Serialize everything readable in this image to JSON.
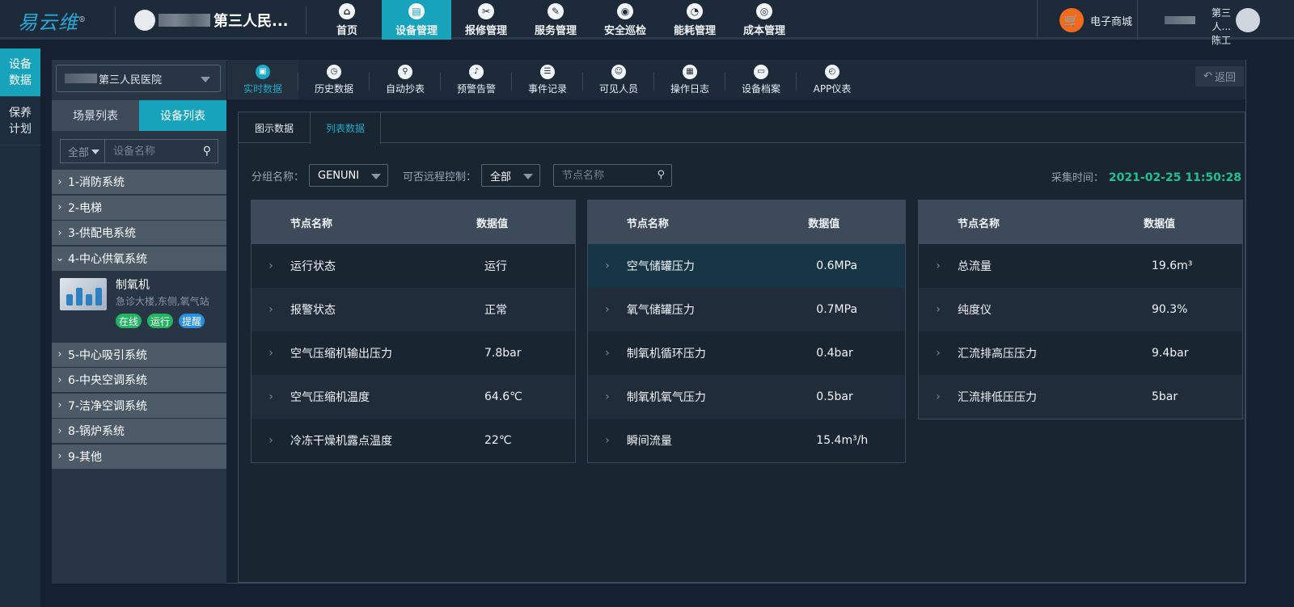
{
  "header": {
    "logo": "易云维",
    "logo_mark": "®",
    "hospital_name": "第三人民...",
    "nav": [
      {
        "label": "首页",
        "icon": "home-icon",
        "glyph": "⌂"
      },
      {
        "label": "设备管理",
        "icon": "device-icon",
        "glyph": "▤"
      },
      {
        "label": "报修管理",
        "icon": "repair-icon",
        "glyph": "✂"
      },
      {
        "label": "服务管理",
        "icon": "service-icon",
        "glyph": "✎"
      },
      {
        "label": "安全巡检",
        "icon": "patrol-icon",
        "glyph": "◉"
      },
      {
        "label": "能耗管理",
        "icon": "energy-icon",
        "glyph": "◔"
      },
      {
        "label": "成本管理",
        "icon": "cost-icon",
        "glyph": "◎"
      }
    ],
    "active_nav": 1,
    "shop_label": "电子商城",
    "user_org": "第三人...",
    "user_name": "陈工"
  },
  "leftbar": {
    "items": [
      {
        "label": "设备数据",
        "line1": "设备",
        "line2": "数据"
      },
      {
        "label": "保养计划",
        "line1": "保养",
        "line2": "计划"
      }
    ]
  },
  "sidebar": {
    "hospital_select": "第三人民医院",
    "tabs": [
      "场景列表",
      "设备列表"
    ],
    "active_tab": 1,
    "filter_all": "全部",
    "search_placeholder": "设备名称",
    "tree": [
      {
        "label": "1-消防系统",
        "expanded": false
      },
      {
        "label": "2-电梯",
        "expanded": false
      },
      {
        "label": "3-供配电系统",
        "expanded": false
      },
      {
        "label": "4-中心供氧系统",
        "expanded": true
      },
      {
        "label": "5-中心吸引系统",
        "expanded": false
      },
      {
        "label": "6-中央空调系统",
        "expanded": false
      },
      {
        "label": "7-洁净空调系统",
        "expanded": false
      },
      {
        "label": "8-锅炉系统",
        "expanded": false
      },
      {
        "label": "9-其他",
        "expanded": false
      }
    ],
    "device": {
      "name": "制氧机",
      "location": "急诊大楼,东侧,氧气站",
      "badges": [
        "在线",
        "运行",
        "提醒"
      ]
    }
  },
  "subnav": {
    "items": [
      {
        "label": "实时数据",
        "icon": "realtime-icon",
        "glyph": "▣"
      },
      {
        "label": "历史数据",
        "icon": "history-icon",
        "glyph": "◷"
      },
      {
        "label": "自动抄表",
        "icon": "meter-icon",
        "glyph": "⚲"
      },
      {
        "label": "预警告警",
        "icon": "alarm-bell-icon",
        "glyph": "♪"
      },
      {
        "label": "事件记录",
        "icon": "event-log-icon",
        "glyph": "☰"
      },
      {
        "label": "可见人员",
        "icon": "people-icon",
        "glyph": "☺"
      },
      {
        "label": "操作日志",
        "icon": "operation-log-icon",
        "glyph": "▦"
      },
      {
        "label": "设备档案",
        "icon": "archive-icon",
        "glyph": "▭"
      },
      {
        "label": "APP仪表",
        "icon": "gauge-icon",
        "glyph": "◴"
      }
    ],
    "active": 0,
    "back_label": "返回"
  },
  "main": {
    "tabs": [
      "图示数据",
      "列表数据"
    ],
    "active_tab": 1,
    "group_label": "分组名称：",
    "group_value": "GENUNI",
    "remote_label": "可否远程控制：",
    "remote_value": "全部",
    "node_placeholder": "节点名称",
    "collect_label": "采集时间：",
    "collect_time": "2021-02-25 11:50:28",
    "col_name": "节点名称",
    "col_value": "数据值",
    "tables": [
      {
        "rows": [
          {
            "name": "运行状态",
            "value": "运行"
          },
          {
            "name": "报警状态",
            "value": "正常"
          },
          {
            "name": "空气压缩机输出压力",
            "value": "7.8bar"
          },
          {
            "name": "空气压缩机温度",
            "value": "64.6℃"
          },
          {
            "name": "冷冻干燥机露点温度",
            "value": "22℃"
          }
        ]
      },
      {
        "rows": [
          {
            "name": "空气储罐压力",
            "value": "0.6MPa"
          },
          {
            "name": "氧气储罐压力",
            "value": "0.7MPa"
          },
          {
            "name": "制氧机循环压力",
            "value": "0.4bar"
          },
          {
            "name": "制氧机氧气压力",
            "value": "0.5bar"
          },
          {
            "name": "瞬间流量",
            "value": "15.4m³/h"
          }
        ]
      },
      {
        "rows": [
          {
            "name": "总流量",
            "value": "19.6m³"
          },
          {
            "name": "纯度仪",
            "value": "90.3%"
          },
          {
            "name": "汇流排高压压力",
            "value": "9.4bar"
          },
          {
            "name": "汇流排低压压力",
            "value": "5bar"
          }
        ]
      }
    ]
  },
  "colors": {
    "accent": "#18a3bd",
    "time": "#21c08f",
    "shop": "#f26b1d"
  }
}
